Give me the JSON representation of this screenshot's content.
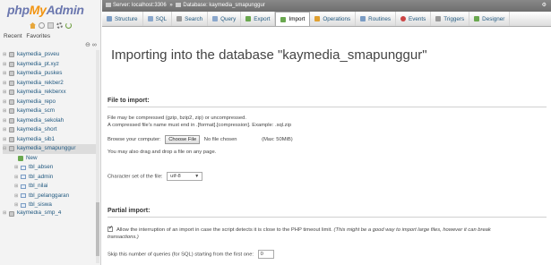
{
  "logo": {
    "php": "php",
    "my": "My",
    "admin": "Admin"
  },
  "nav": {
    "tabs": [
      "Recent",
      "Favorites"
    ],
    "collapse_symbol": "⊖ ∞",
    "databases": [
      {
        "label": "kaymedia_psveu"
      },
      {
        "label": "kaymedia_pt.xyz"
      },
      {
        "label": "kaymedia_puskes"
      },
      {
        "label": "kaymedia_rekber2"
      },
      {
        "label": "kaymedia_rekberxx"
      },
      {
        "label": "kaymedia_repo"
      },
      {
        "label": "kaymedia_scm"
      },
      {
        "label": "kaymedia_sekolah"
      },
      {
        "label": "kaymedia_short"
      },
      {
        "label": "kaymedia_sib1"
      },
      {
        "label": "kaymedia_smapunggur"
      }
    ],
    "new_label": "New",
    "tables": [
      {
        "label": "tbl_absen"
      },
      {
        "label": "tbl_admin"
      },
      {
        "label": "tbl_nilai"
      },
      {
        "label": "tbl_pelanggaran"
      },
      {
        "label": "tbl_siswa"
      }
    ],
    "next_db": "kaymedia_smp_4"
  },
  "breadcrumb": {
    "server": "Server: localhost:3306",
    "separator": "»",
    "database": "Database: kaymedia_smapunggur"
  },
  "menu": {
    "tabs": [
      {
        "label": "Structure",
        "icon": "structure-icon",
        "color": "#7a9cc4"
      },
      {
        "label": "SQL",
        "icon": "sql-icon",
        "color": "#8aa7cc"
      },
      {
        "label": "Search",
        "icon": "search-icon",
        "color": "#999999"
      },
      {
        "label": "Query",
        "icon": "query-icon",
        "color": "#8aa7cc"
      },
      {
        "label": "Export",
        "icon": "export-icon",
        "color": "#6aa84f"
      },
      {
        "label": "Import",
        "icon": "import-icon",
        "color": "#6aa84f",
        "active": true
      },
      {
        "label": "Operations",
        "icon": "operations-icon",
        "color": "#e0a030"
      },
      {
        "label": "Routines",
        "icon": "routines-icon",
        "color": "#7a9cc4"
      },
      {
        "label": "Events",
        "icon": "events-icon",
        "color": "#cc4444"
      },
      {
        "label": "Triggers",
        "icon": "triggers-icon",
        "color": "#999999"
      },
      {
        "label": "Designer",
        "icon": "designer-icon",
        "color": "#6aa84f"
      }
    ]
  },
  "main": {
    "title": "Importing into the database \"kaymedia_smapunggur\"",
    "file_section": {
      "heading": "File to import:",
      "note1": "File may be compressed (gzip, bzip2, zip) or uncompressed.",
      "note2": "A compressed file's name must end in .[format].[compression]. Example: .sql.zip",
      "browse_label": "Browse your computer:",
      "choose_button": "Choose File",
      "no_file": "No file chosen",
      "max_size": "(Max: 50MiB)",
      "drag_note": "You may also drag and drop a file on any page.",
      "charset_label": "Character set of the file:",
      "charset_value": "utf-8"
    },
    "partial_section": {
      "heading": "Partial import:",
      "allow_interrupt": "Allow the interruption of an import in case the script detects it is close to the PHP timeout limit.",
      "allow_interrupt_note": "(This might be a good way to import large files, however it can break",
      "allow_interrupt_note2": "transactions.)",
      "allow_checked": true,
      "skip_label": "Skip this number of queries (for SQL) starting from the first one:",
      "skip_value": "0"
    }
  }
}
